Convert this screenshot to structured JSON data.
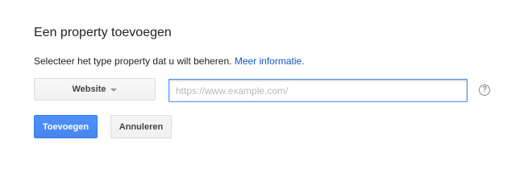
{
  "dialog": {
    "title": "Een property toevoegen",
    "description": "Selecteer het type property dat u wilt beheren.",
    "more_info_link": "Meer informatie.",
    "property_type": {
      "selected": "Website"
    },
    "url_input": {
      "value": "",
      "placeholder": "https://www.example.com/"
    },
    "help_icon": "?",
    "buttons": {
      "add": "Toevoegen",
      "cancel": "Annuleren"
    }
  },
  "colors": {
    "primary_button": "#4d90fe",
    "link": "#1155cc",
    "input_focus_border": "#4d90fe"
  },
  "icons": {
    "dropdown": "caret-down-icon",
    "help": "help-circle-icon"
  }
}
